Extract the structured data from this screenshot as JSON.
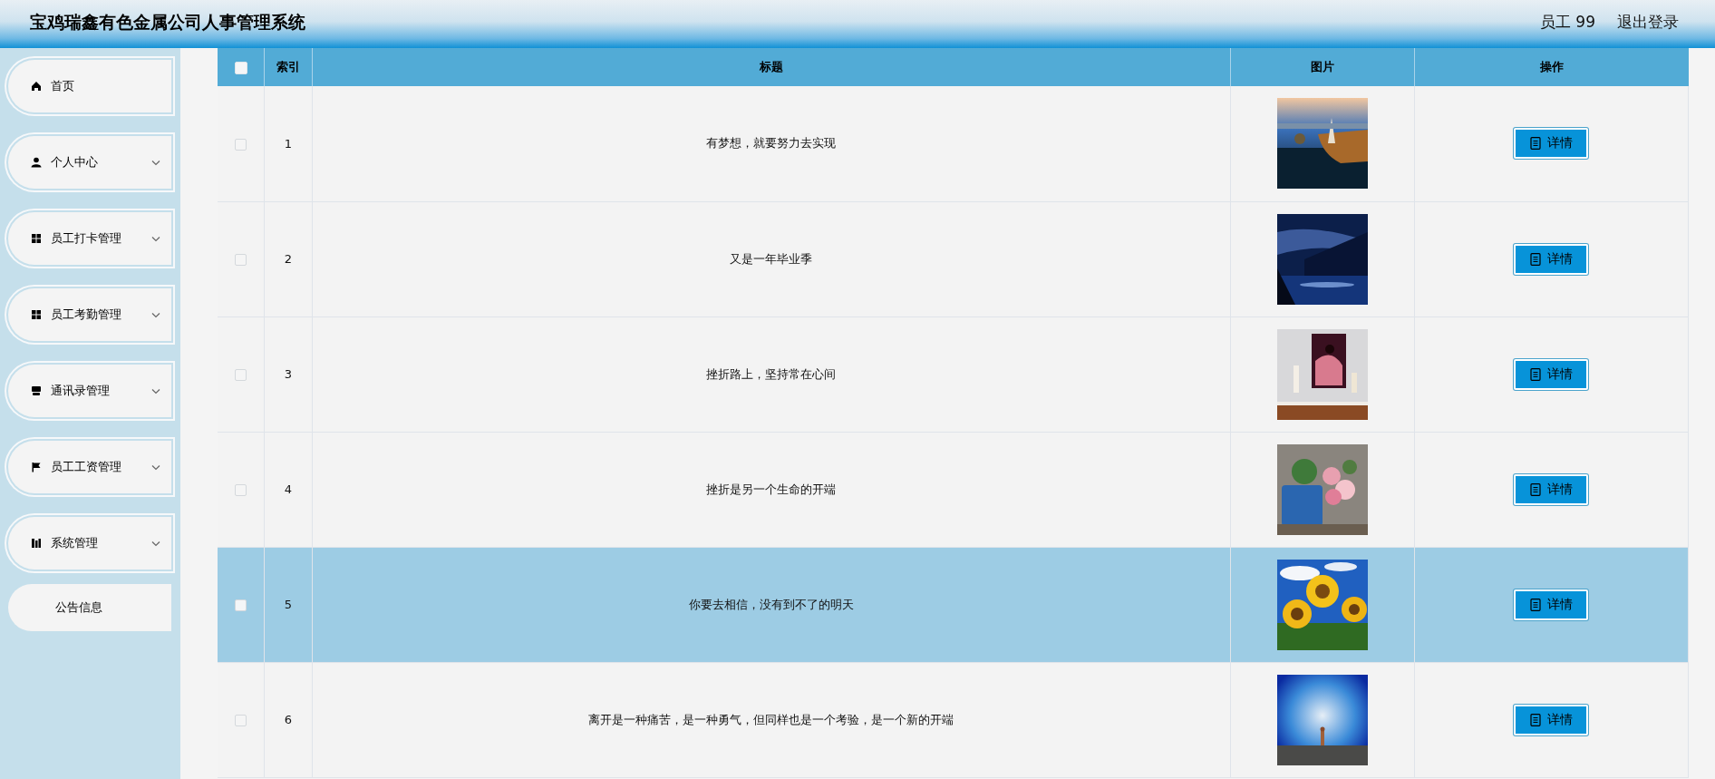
{
  "header": {
    "title": "宝鸡瑞鑫有色金属公司人事管理系统",
    "user": "员工 99",
    "logout": "退出登录"
  },
  "sidebar": {
    "items": [
      {
        "label": "首页",
        "kind": "menu",
        "expandable": false
      },
      {
        "label": "个人中心",
        "kind": "menu",
        "expandable": true
      },
      {
        "label": "员工打卡管理",
        "kind": "menu",
        "expandable": true
      },
      {
        "label": "员工考勤管理",
        "kind": "menu",
        "expandable": true
      },
      {
        "label": "通讯录管理",
        "kind": "menu",
        "expandable": true
      },
      {
        "label": "员工工资管理",
        "kind": "menu",
        "expandable": true
      },
      {
        "label": "系统管理",
        "kind": "menu",
        "expandable": true
      },
      {
        "label": "公告信息",
        "kind": "plain",
        "expandable": false
      }
    ]
  },
  "table": {
    "select_all": {
      "checked": false
    },
    "columns": [
      "索引",
      "标题",
      "图片",
      "操作"
    ],
    "rows": [
      {
        "checked": false,
        "selected": false,
        "index": "1",
        "title": "有梦想，就要努力去实现",
        "action": "详情"
      },
      {
        "checked": false,
        "selected": false,
        "index": "2",
        "title": "又是一年毕业季",
        "action": "详情"
      },
      {
        "checked": false,
        "selected": false,
        "index": "3",
        "title": "挫折路上，坚持常在心间",
        "action": "详情"
      },
      {
        "checked": false,
        "selected": false,
        "index": "4",
        "title": "挫折是另一个生命的开端",
        "action": "详情"
      },
      {
        "checked": false,
        "selected": true,
        "index": "5",
        "title": "你要去相信，没有到不了的明天",
        "action": "详情"
      },
      {
        "checked": false,
        "selected": false,
        "index": "6",
        "title": "离开是一种痛苦，是一种勇气，但同样也是一个考验，是一个新的开端",
        "action": "详情"
      }
    ]
  }
}
